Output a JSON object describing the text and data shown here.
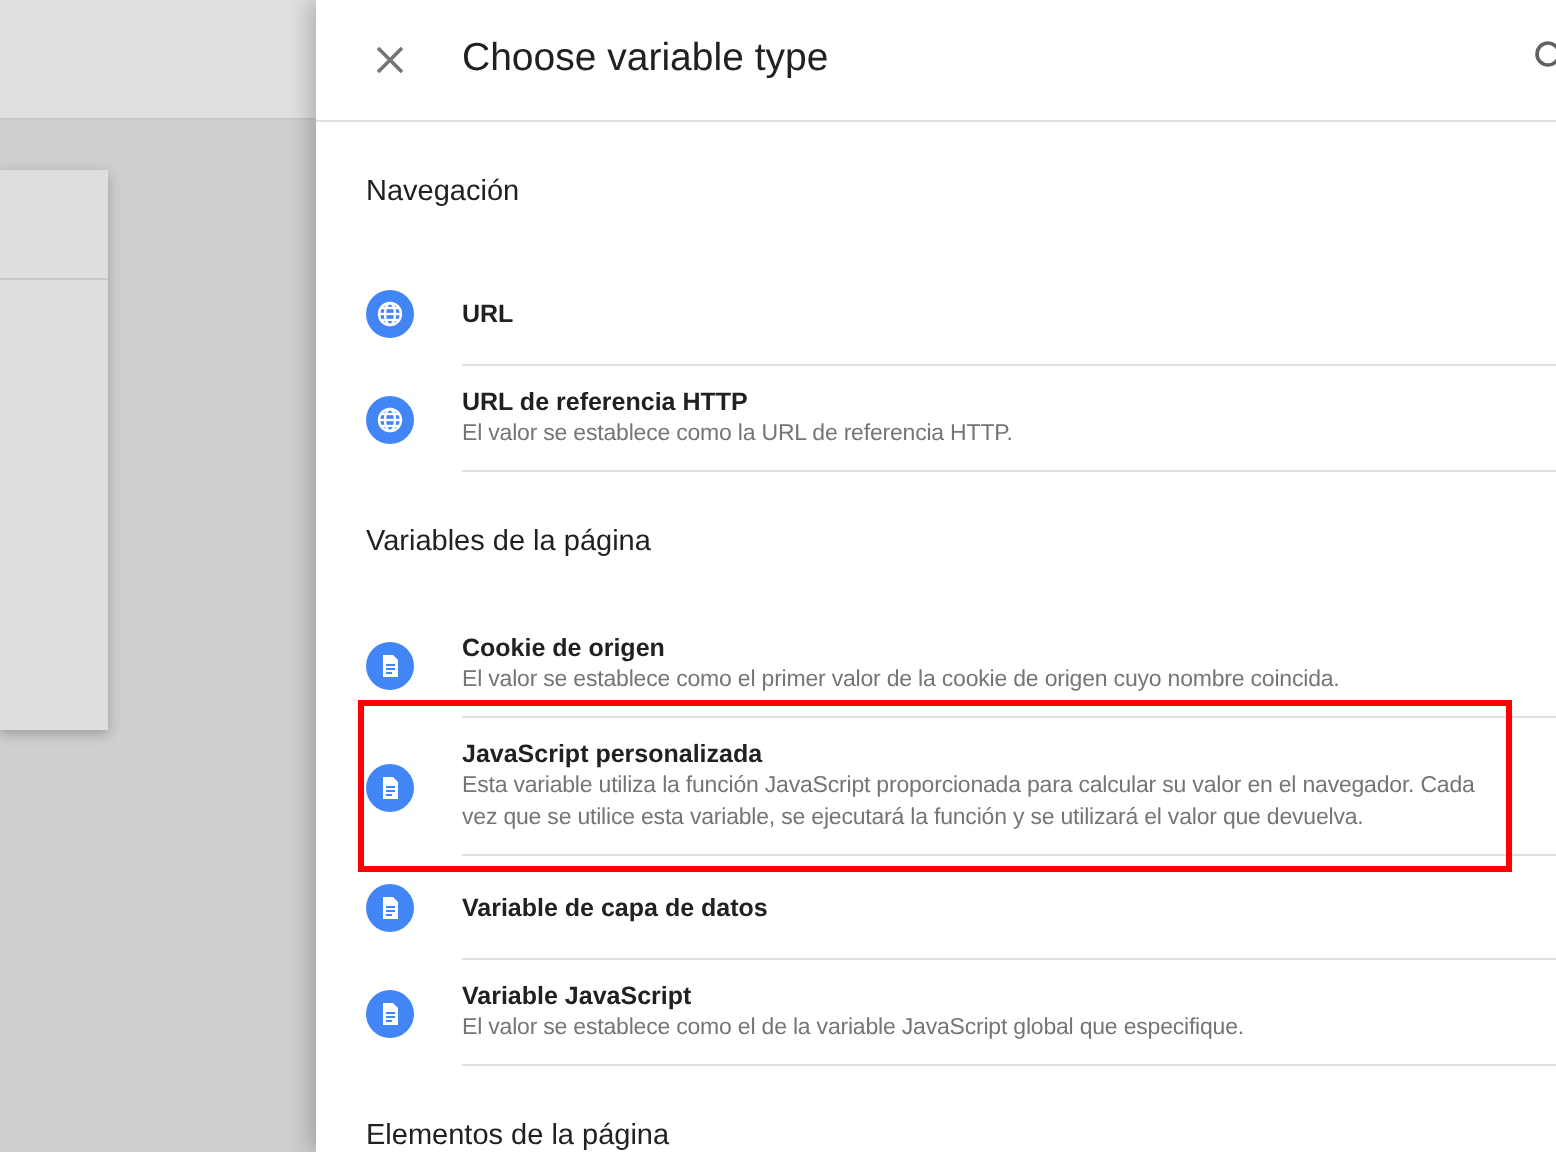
{
  "panel": {
    "title": "Choose variable type"
  },
  "sections": [
    {
      "heading": "Navegación",
      "items": [
        {
          "kind": "globe",
          "title": "URL",
          "highlighted": false
        },
        {
          "kind": "globe",
          "title": "URL de referencia HTTP",
          "description": "El valor se establece como la URL de referencia HTTP.",
          "highlighted": false
        }
      ]
    },
    {
      "heading": "Variables de la página",
      "items": [
        {
          "kind": "doc",
          "title": "Cookie de origen",
          "description": "El valor se establece como el primer valor de la cookie de origen cuyo nombre coincida.",
          "highlighted": false
        },
        {
          "kind": "doc",
          "title": "JavaScript personalizada",
          "description": "Esta variable utiliza la función JavaScript proporcionada para calcular su valor en el navegador. Cada vez que se utilice esta variable, se ejecutará la función y se utilizará el valor que devuelva.",
          "highlighted": true
        },
        {
          "kind": "doc",
          "title": "Variable de capa de datos",
          "highlighted": false
        },
        {
          "kind": "doc",
          "title": "Variable JavaScript",
          "description": "El valor se establece como el de la variable JavaScript global que especifique.",
          "highlighted": false
        }
      ]
    },
    {
      "heading": "Elementos de la página"
    }
  ]
}
